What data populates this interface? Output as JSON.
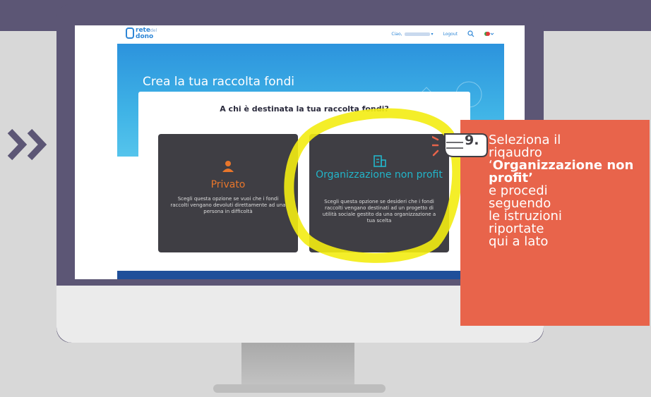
{
  "site": {
    "greeting": "Ciao,",
    "logout": "Logout",
    "hero_title": "Crea la tua raccolta fondi",
    "question": "A chi è destinata la tua raccolta fondi?",
    "logo_text_top": "rete",
    "logo_text_small": "del",
    "logo_text_bottom": "dono",
    "cards": [
      {
        "title": "Privato",
        "description": "Scegli questa opzione se vuoi che i fondi raccolti vengano devoluti direttamente ad una persona in difficoltà"
      },
      {
        "title": "Organizzazione non profit",
        "description": "Scegli questa opzione se desideri che i fondi raccolti vengano destinati ad un progetto di utilità sociale gestito da una organizzazione a tua scelta"
      }
    ]
  },
  "callout": {
    "step": "9.",
    "line1": "Seleziona il",
    "line2": "riqaudro",
    "quote_open": "‘",
    "bold": "Organizzazione non profit’",
    "rest": [
      "e procedi",
      "seguendo",
      "le istruzioni",
      "riportate",
      "qui a lato"
    ]
  },
  "colors": {
    "frame": "#5c5675",
    "accent_orange": "#e8762b",
    "accent_teal": "#22b5c9",
    "callout": "#e8644b",
    "highlight": "#f3ec12"
  },
  "icons": [
    "chevron-double-right-icon",
    "user-icon",
    "building-icon",
    "search-icon",
    "italy-flag-icon",
    "pointing-hand-icon"
  ]
}
